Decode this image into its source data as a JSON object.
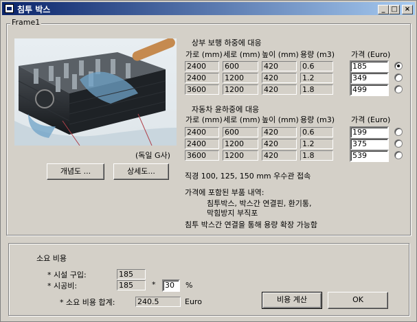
{
  "window": {
    "title": "침투 박스",
    "controls": {
      "minimize": "_",
      "maximize": "□",
      "close": "×"
    }
  },
  "frame1": {
    "label": "Frame1",
    "image_caption": "(독일 G사)",
    "buttons": {
      "concept": "개념도 ...",
      "detail": "상세도..."
    }
  },
  "section1": {
    "title": "상부 보행 하중에 대응",
    "headers": [
      "가로 (mm)",
      "세로 (mm)",
      "높이 (mm)",
      "용량 (m3)",
      "가격 (Euro)"
    ],
    "rows": [
      {
        "w": "2400",
        "d": "600",
        "h": "420",
        "cap": "0.6",
        "price": "185",
        "selected": true
      },
      {
        "w": "2400",
        "d": "1200",
        "h": "420",
        "cap": "1.2",
        "price": "349",
        "selected": false
      },
      {
        "w": "3600",
        "d": "1200",
        "h": "420",
        "cap": "1.8",
        "price": "499",
        "selected": false
      }
    ]
  },
  "section2": {
    "title": "자동차 윤하중에 대응",
    "headers": [
      "가로 (mm)",
      "세로 (mm)",
      "높이 (mm)",
      "용량 (m3)",
      "가격 (Euro)"
    ],
    "rows": [
      {
        "w": "2400",
        "d": "600",
        "h": "420",
        "cap": "0.6",
        "price": "199",
        "selected": false
      },
      {
        "w": "2400",
        "d": "1200",
        "h": "420",
        "cap": "1.2",
        "price": "375",
        "selected": false
      },
      {
        "w": "3600",
        "d": "1200",
        "h": "420",
        "cap": "1.8",
        "price": "539",
        "selected": false
      }
    ]
  },
  "notes": {
    "diameter": "직경 100, 125, 150 mm 우수관 접속",
    "parts_title": "가격에 포함된 부품 내역:",
    "parts_line1": "침투박스, 박스간 연결핀, 환기통,",
    "parts_line2": "막힘방지 부직포",
    "expand": "침투 박스간 연결을 통해 용량 확장 가능함"
  },
  "cost": {
    "group_label": "소요 비용",
    "purchase_label": "* 시설 구입:",
    "purchase_value": "185",
    "install_label": "* 시공비:",
    "install_value": "185",
    "multiply": "*",
    "percent_value": "30",
    "percent_sign": "%",
    "total_label": "* 소요 비용 합계:",
    "total_value": "240.5",
    "currency": "Euro",
    "calc_button": "비용 계산",
    "ok_button": "OK"
  }
}
